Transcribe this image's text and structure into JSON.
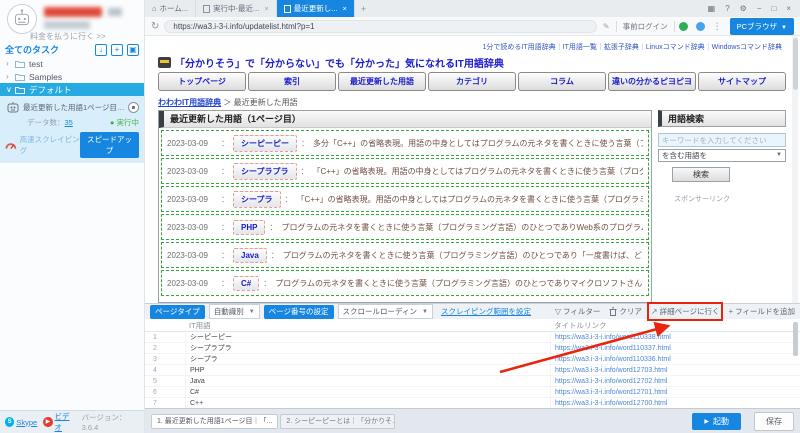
{
  "colors": {
    "accent": "#1786e0",
    "selected_blue": "#25aae1",
    "running_green": "#43b244",
    "annotation_red": "#e8250c",
    "site_link_blue": "#1a1acc"
  },
  "icons": {
    "home": "⌂",
    "close": "×",
    "new_tab": "+",
    "grid": "▦",
    "help": "?",
    "gear": "⚙",
    "minimize": "−",
    "restore": "□",
    "refresh": "↻",
    "edit": "✎",
    "more": "⋮",
    "dropdown": "▼",
    "filter": "▽",
    "goto": "↗",
    "add_field": "+",
    "play": "▶",
    "chevron_collapsed": "›",
    "chevron_expanded": "∨",
    "import_task": "↓",
    "new_task": "+",
    "new_group": "▣"
  },
  "sidebar": {
    "pay_link": "料金を払うに行く >>",
    "all_tasks_label": "全てのタスク",
    "folders": [
      {
        "label": "test"
      },
      {
        "label": "Samples"
      },
      {
        "label": "デフォルト"
      }
    ],
    "task": {
      "name": "最近更新した用語1ページ目｜「分かりそう...",
      "data_count_label": "データ数：",
      "data_count": "35",
      "status": "● 実行中",
      "fast_label": "高速スクレイピング",
      "speedup_button": "スピードアップ"
    },
    "skype_label": "Skype",
    "skype_initial": "S",
    "video_label": "ビデオ",
    "video_glyph": "▶",
    "version": "バージョン：3.6.4"
  },
  "browser": {
    "tabs": {
      "home": "ホーム...",
      "tab2": "実行中-最近...",
      "tab3": "最近更新し..."
    },
    "url": "https://wa3.i-3-i.info/updatelist.html?p=1",
    "prelogin": "事前ログイン",
    "browser_mode": "PCブラウザ"
  },
  "webpage": {
    "top_links": [
      "1分で読めるIT用語辞典",
      "IT用語一覧",
      "拡張子辞典",
      "Linuxコマンド辞典",
      "Windowsコマンド辞典"
    ],
    "site_title": "「分かりそう」で「分からない」でも「分かった」気になれるIT用語辞典",
    "nav": [
      "トップページ",
      "索引",
      "最近更新した用語",
      "カテゴリ",
      "コラム",
      "違いの分かるピヨピヨ",
      "サイトマップ"
    ],
    "breadcrumb": {
      "home": "わわわIT用語辞典",
      "sep": "＞",
      "current": "最近更新した用語"
    },
    "list_title": "最近更新した用語（1ページ目）",
    "row_sep": "：",
    "rows": [
      {
        "date": "2023-03-09",
        "term": "シーピーピー",
        "desc": "多分「C++」の省略表現。用語の中身としてはプログラムの元ネタを書くときに使う言葉（プロ…"
      },
      {
        "date": "2023-03-09",
        "term": "シープラプラ",
        "desc": "「C++」の省略表現。用語の中身としてはプログラムの元ネタを書くときに使う言葉（プログラ…"
      },
      {
        "date": "2023-03-09",
        "term": "シープラ",
        "desc": "「C++」の省略表現。用語の中身としてはプログラムの元ネタを書くときに使う言葉（プログラミン…"
      },
      {
        "date": "2023-03-09",
        "term": "PHP",
        "desc": "プログラムの元ネタを書くときに使う言葉（プログラミング言語）のひとつでありWeb系のプログラムを…"
      },
      {
        "date": "2023-03-09",
        "term": "Java",
        "desc": "プログラムの元ネタを書くときに使う言葉（プログラミング言語）のひとつであり「一度書けば、どこで…"
      },
      {
        "date": "2023-03-09",
        "term": "C#",
        "desc": "プログラムの元ネタを書くときに使う言葉（プログラミング言語）のひとつでありマイクロソフトさんが作…"
      }
    ],
    "search": {
      "title": "用語検索",
      "placeholder": "キーワードを入力してください",
      "select_value": "を含む用語を",
      "button": "検索",
      "sponsor": "スポンサーリンク"
    }
  },
  "panel": {
    "page_type_label": "ページタイプ",
    "page_type_value": "自動識別",
    "page_number_label": "ページ番号の設定",
    "page_number_value": "スクロールローディン",
    "range_link": "スクレイピング範囲を設定",
    "filter_label": "フィルター",
    "clear_label": "クリア",
    "detail_label": "詳細ページに行く",
    "add_field_label": "フィールドを追加",
    "col_term": "IT用語",
    "col_link": "タイトルリンク",
    "rows": [
      {
        "n": "1",
        "term": "シーピーピー",
        "link": "https://wa3.i-3-i.info/word110338.html"
      },
      {
        "n": "2",
        "term": "シープラプラ",
        "link": "https://wa3.i-3-i.info/word110337.html"
      },
      {
        "n": "3",
        "term": "シープラ",
        "link": "https://wa3.i-3-i.info/word110336.html"
      },
      {
        "n": "4",
        "term": "PHP",
        "link": "https://wa3.i-3-i.info/word12703.html"
      },
      {
        "n": "5",
        "term": "Java",
        "link": "https://wa3.i-3-i.info/word12702.html"
      },
      {
        "n": "6",
        "term": "C#",
        "link": "https://wa3.i-3-i.info/word12701.html"
      },
      {
        "n": "7",
        "term": "C++",
        "link": "https://wa3.i-3-i.info/word12700.html"
      }
    ]
  },
  "footer": {
    "tab1": "1. 最近更新した用語1ページ目｜「...",
    "tab2": "2. シーピーピーとは｜「分かりそ...",
    "run_button": "起動",
    "save_button": "保存"
  }
}
